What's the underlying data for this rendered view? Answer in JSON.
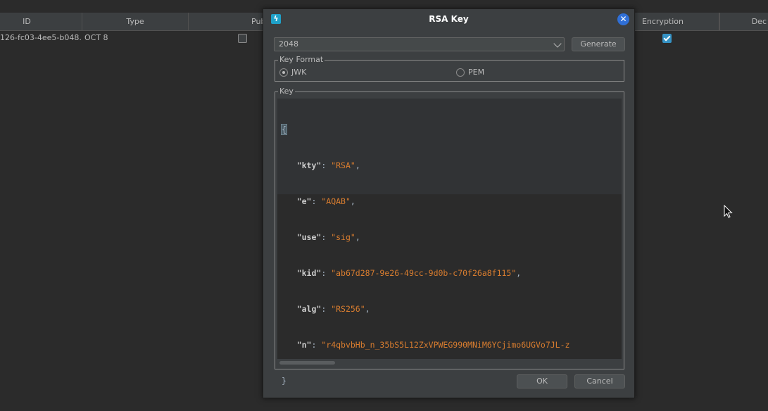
{
  "table": {
    "columns": [
      "ID",
      "Type",
      "Public Key",
      "Encryption",
      "Dec"
    ],
    "row": {
      "id": "126-fc03-4ee5-b048...",
      "type": "OCT 8",
      "public_key": false,
      "encryption": true
    }
  },
  "dialog": {
    "title": "RSA Key",
    "icon": "lightning-icon",
    "key_size": "2048",
    "generate_label": "Generate",
    "key_format": {
      "legend": "Key Format",
      "options": [
        "JWK",
        "PEM"
      ],
      "selected": "JWK"
    },
    "key": {
      "legend": "Key",
      "open_brace": "{",
      "close_brace": "}",
      "fields": [
        {
          "name": "\"kty\"",
          "value": "\"RSA\"",
          "sep": ","
        },
        {
          "name": "\"e\"",
          "value": "\"AQAB\"",
          "sep": ","
        },
        {
          "name": "\"use\"",
          "value": "\"sig\"",
          "sep": ","
        },
        {
          "name": "\"kid\"",
          "value": "\"ab67d287-9e26-49cc-9d0b-c70f26a8f115\"",
          "sep": ","
        },
        {
          "name": "\"alg\"",
          "value": "\"RS256\"",
          "sep": ","
        },
        {
          "name": "\"n\"",
          "value": "\"r4qbvbHb_n_35bS5L12ZxVPWEG990MNiM6YCjimo6UGVo7JL-z",
          "sep": ""
        }
      ]
    },
    "ok_label": "OK",
    "cancel_label": "Cancel"
  },
  "colors": {
    "background": "#2b2b2b",
    "dialog": "#3c3f41",
    "accent": "#3592c4",
    "string": "#d97d2f",
    "close": "#2f6fd6"
  }
}
